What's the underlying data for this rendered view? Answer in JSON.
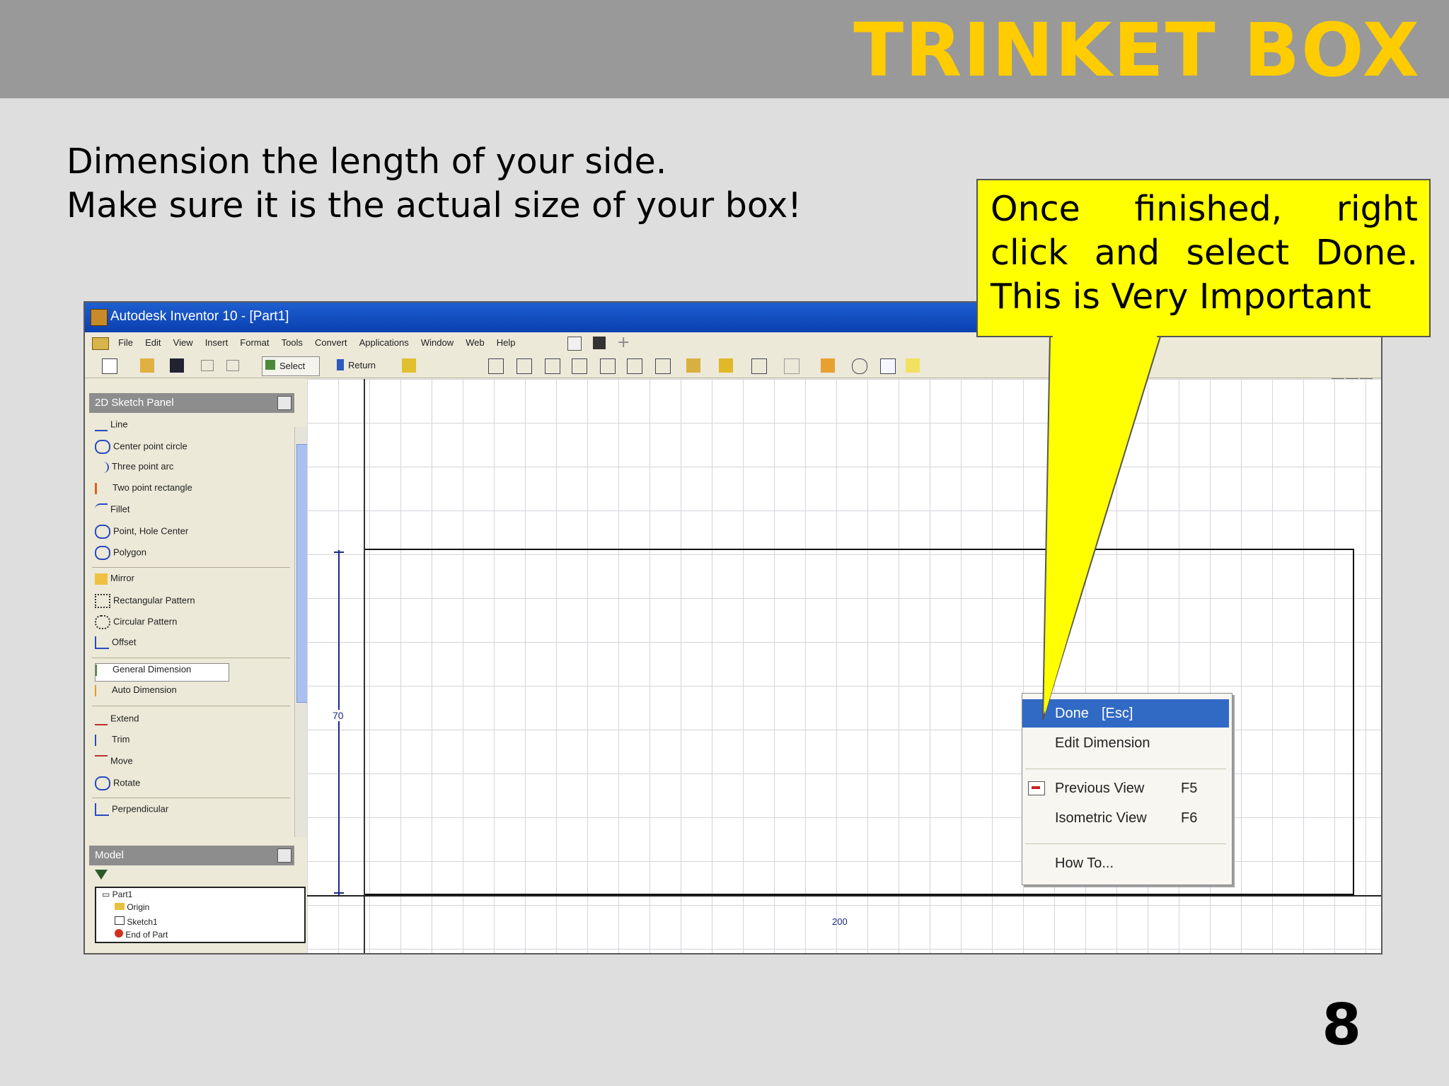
{
  "slide": {
    "title": "TRINKET BOX",
    "title_color": "#ffcc00",
    "header_bg": "#999999",
    "instruction_lines": [
      "Dimension the length of your side.",
      "Make sure it is the actual size of your box!"
    ],
    "page_number": "8"
  },
  "callout": {
    "text": "Once finished, right click and select Done. This is Very Important",
    "bg": "#ffff00"
  },
  "window": {
    "title": "Autodesk Inventor 10 - [Part1]",
    "menu": [
      "File",
      "Edit",
      "View",
      "Insert",
      "Format",
      "Tools",
      "Convert",
      "Applications",
      "Window",
      "Web",
      "Help"
    ],
    "toolbar": {
      "select_label": "Select",
      "return_label": "Return"
    }
  },
  "sketch_panel": {
    "title": "2D Sketch Panel",
    "items": [
      "Line",
      "Center point circle",
      "Three point arc",
      "Two point rectangle",
      "Fillet",
      "Point, Hole Center",
      "Polygon",
      "Mirror",
      "Rectangular Pattern",
      "Circular Pattern",
      "Offset",
      "General Dimension",
      "Auto Dimension",
      "Extend",
      "Trim",
      "Move",
      "Rotate",
      "Perpendicular"
    ]
  },
  "model_panel": {
    "title": "Model",
    "tree": [
      "Part1",
      "Origin",
      "Sketch1",
      "End of Part"
    ]
  },
  "canvas": {
    "dimension_value": "70",
    "bottom_label": "200"
  },
  "context_menu": {
    "items": [
      {
        "label": "Done",
        "shortcut": "[Esc]",
        "selected": true
      },
      {
        "label": "Edit Dimension",
        "shortcut": ""
      },
      {
        "label": "Previous View",
        "shortcut": "F5"
      },
      {
        "label": "Isometric View",
        "shortcut": "F6"
      },
      {
        "label": "How To...",
        "shortcut": ""
      }
    ]
  }
}
